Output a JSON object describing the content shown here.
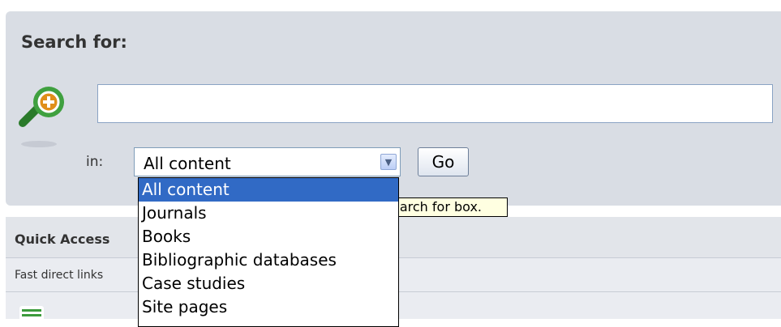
{
  "search": {
    "title": "Search for:",
    "query_value": "",
    "scope_label": "in:",
    "scope_selected": "All content",
    "go_label": "Go",
    "tooltip_text": "earch for box."
  },
  "dropdown": {
    "options": [
      "All content",
      "Journals",
      "Books",
      "Bibliographic databases",
      "Case studies",
      "Site pages"
    ],
    "highlighted_index": 0
  },
  "quick_access": {
    "title": "Quick Access",
    "subtitle": "Fast direct links"
  },
  "icons": {
    "search": "magnifier-plus-icon",
    "dropdown_arrow": "chevron-down-icon",
    "list": "list-icon"
  },
  "colors": {
    "panel_bg": "#d9dde4",
    "highlight": "#316ac5",
    "magnifier": "#2e8b2e",
    "plus_badge": "#e08f1a",
    "tooltip_bg": "#ffffe1"
  }
}
